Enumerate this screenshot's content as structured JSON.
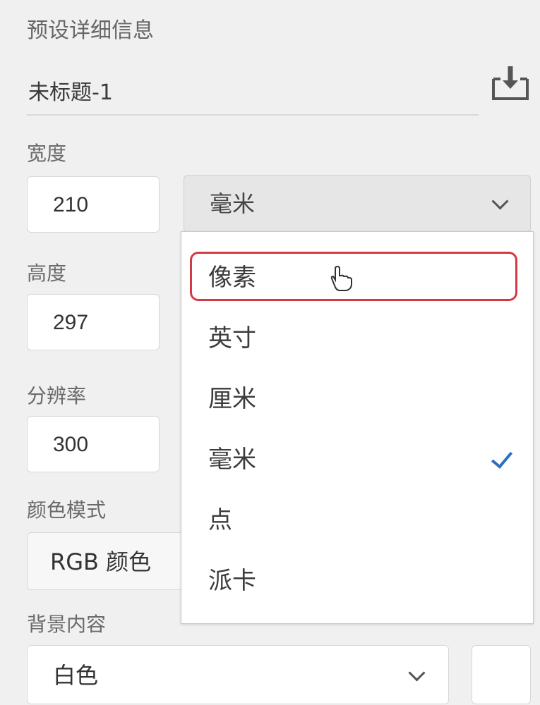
{
  "preset": {
    "section_title": "预设详细信息",
    "doc_name": "未标题-1",
    "save_icon": "save-preset-icon"
  },
  "width": {
    "label": "宽度",
    "value": "210",
    "unit": "毫米"
  },
  "height": {
    "label": "高度",
    "value": "297"
  },
  "resolution": {
    "label": "分辨率",
    "value": "300"
  },
  "color_mode": {
    "label": "颜色模式",
    "value": "RGB 颜色"
  },
  "background": {
    "label": "背景内容",
    "value": "白色",
    "swatch_color": "#ffffff"
  },
  "unit_dropdown": {
    "options": [
      "像素",
      "英寸",
      "厘米",
      "毫米",
      "点",
      "派卡"
    ],
    "hovered": "像素",
    "checked": "毫米",
    "highlight_color": "#d23b45",
    "check_color": "#2c6fc4"
  }
}
